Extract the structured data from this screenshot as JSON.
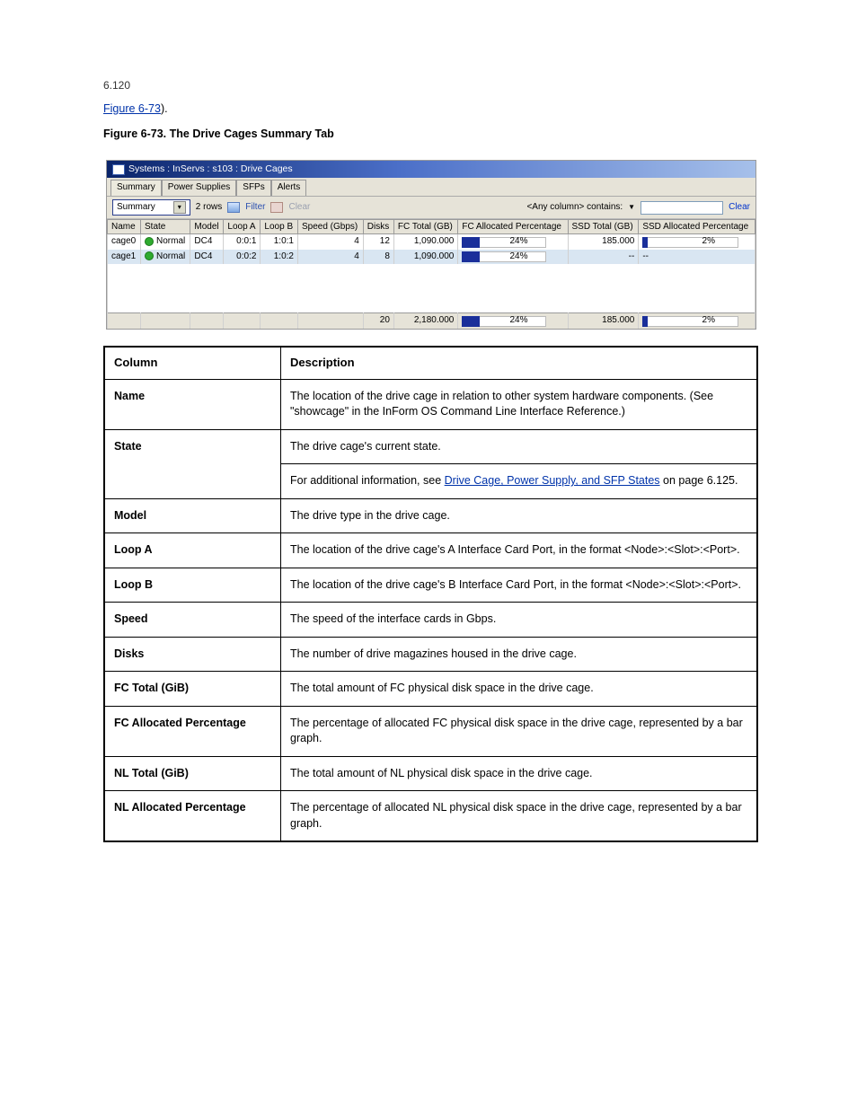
{
  "page_number": "6.120",
  "intro": {
    "p1_a": "Figure 6-73",
    "p1_b": ").",
    "p2": "Figure 6-73.  The Drive Cages Summary Tab"
  },
  "shot": {
    "title": "Systems : InServs : s103 : Drive Cages",
    "tabs": [
      "Summary",
      "Power Supplies",
      "SFPs",
      "Alerts"
    ],
    "view_dd": "Summary",
    "rows_label": "2 rows",
    "filter_label": "Filter",
    "clear_label": "Clear",
    "anycol": "<Any column> contains:",
    "clear_link": "Clear",
    "headers": [
      "Name",
      "State",
      "Model",
      "Loop A",
      "Loop B",
      "Speed (Gbps)",
      "Disks",
      "FC Total (GB)",
      "FC Allocated Percentage",
      "SSD Total (GB)",
      "SSD Allocated Percentage"
    ],
    "rows": [
      {
        "name": "cage0",
        "state": "Normal",
        "model": "DC4",
        "loopa": "0:0:1",
        "loopb": "1:0:1",
        "speed": "4",
        "disks": "12",
        "fctot": "1,090.000",
        "fcpct": "24%",
        "ssdtot": "185.000",
        "ssdpct": "2%"
      },
      {
        "name": "cage1",
        "state": "Normal",
        "model": "DC4",
        "loopa": "0:0:2",
        "loopb": "1:0:2",
        "speed": "4",
        "disks": "8",
        "fctot": "1,090.000",
        "fcpct": "24%",
        "ssdtot": "--",
        "ssdpct": "--"
      }
    ],
    "totals": {
      "disks": "20",
      "fctot": "2,180.000",
      "fcpct": "24%",
      "ssdtot": "185.000",
      "ssdpct": "2%"
    }
  },
  "defs": {
    "head_col": "Column",
    "head_desc": "Description",
    "rows": [
      {
        "term": "Name",
        "desc": "The location of the drive cage in relation to other system hardware components. (See \"showcage\" in the InForm OS Command Line Interface Reference.)"
      },
      {
        "term": "State",
        "desc": "The drive cage's current state."
      },
      {
        "term": "",
        "desc_a": "For additional information, see ",
        "desc_link": "Drive Cage, Power Supply, and SFP States",
        "desc_b": " on page 6.125."
      },
      {
        "term": "Model",
        "desc": "The drive type in the drive cage."
      },
      {
        "term": "Loop A",
        "desc": "The location of the drive cage's A Interface Card Port, in the format <Node>:<Slot>:<Port>."
      },
      {
        "term": "Loop B",
        "desc": "The location of the drive cage's B Interface Card Port, in the format <Node>:<Slot>:<Port>."
      },
      {
        "term": "Speed",
        "desc": "The speed of the interface cards in Gbps."
      },
      {
        "term": "Disks",
        "desc": "The number of drive magazines housed in the drive cage."
      },
      {
        "term": "FC Total (GiB)",
        "desc": "The total amount of FC physical disk space in the drive cage."
      },
      {
        "term": "FC Allocated Percentage",
        "desc": "The percentage of allocated FC physical disk space in the drive cage, represented by a bar graph."
      },
      {
        "term": "NL Total (GiB)",
        "desc": "The total amount of NL physical disk space in the drive cage."
      },
      {
        "term": "NL Allocated Percentage",
        "desc": "The percentage of allocated NL physical disk space in the drive cage, represented by a bar graph."
      }
    ]
  }
}
